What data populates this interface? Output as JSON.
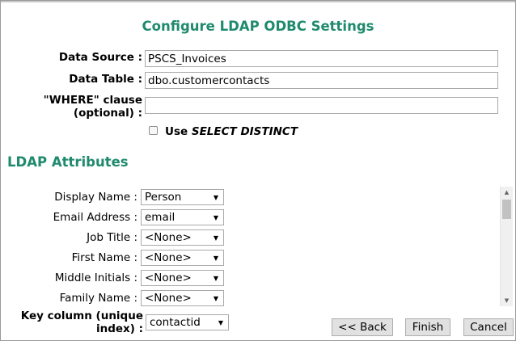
{
  "title": "Configure LDAP ODBC Settings",
  "data_source": {
    "label": "Data Source :",
    "value": "PSCS_Invoices"
  },
  "data_table": {
    "label": "Data Table :",
    "value": "dbo.customercontacts"
  },
  "where_clause": {
    "label_line1": "\"WHERE\" clause",
    "label_line2": "(optional) :",
    "value": ""
  },
  "distinct": {
    "label_prefix": "Use ",
    "label_emphasis": "SELECT DISTINCT",
    "checked": false
  },
  "ldap_section": {
    "title": "LDAP Attributes"
  },
  "attributes": [
    {
      "label": "Display Name :",
      "value": "Person"
    },
    {
      "label": "Email Address :",
      "value": "email"
    },
    {
      "label": "Job Title :",
      "value": "<None>"
    },
    {
      "label": "First Name :",
      "value": "<None>"
    },
    {
      "label": "Middle Initials :",
      "value": "<None>"
    },
    {
      "label": "Family Name :",
      "value": "<None>"
    }
  ],
  "key_column": {
    "label_line1": "Key column (unique",
    "label_line2": "index) :",
    "value": "contactid"
  },
  "buttons": {
    "back": "<< Back",
    "finish": "Finish",
    "cancel": "Cancel"
  },
  "colors": {
    "accent": "#1f8a6d"
  }
}
